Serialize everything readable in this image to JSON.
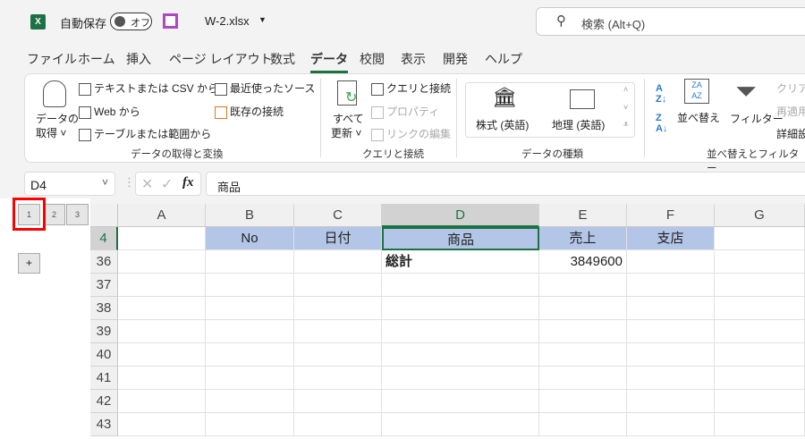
{
  "titlebar": {
    "autosave_label": "自動保存",
    "autosave_state": "オフ",
    "filename": "W-2.xlsx",
    "search_placeholder": "検索 (Alt+Q)"
  },
  "tabs": [
    "ファイル",
    "ホーム",
    "挿入",
    "ページ レイアウト",
    "数式",
    "データ",
    "校閲",
    "表示",
    "開発",
    "ヘルプ"
  ],
  "ribbon": {
    "get_data": {
      "line1": "データの",
      "line2": "取得 ˅",
      "text_csv": "テキストまたは CSV から",
      "web": "Web から",
      "table_range": "テーブルまたは範囲から",
      "recent": "最近使ったソース",
      "existing": "既存の接続",
      "group": "データの取得と変換"
    },
    "queries": {
      "refresh1": "すべて",
      "refresh2": "更新 ˅",
      "queries_conn": "クエリと接続",
      "properties": "プロパティ",
      "edit_links": "リンクの編集",
      "group": "クエリと接続"
    },
    "data_types": {
      "stocks": "株式 (英語)",
      "geography": "地理 (英語)",
      "group": "データの種類"
    },
    "sort_filter": {
      "sort": "並べ替え",
      "filter": "フィルター",
      "clear": "クリア",
      "reapply": "再適用",
      "advanced": "詳細設定",
      "group": "並べ替えとフィルター"
    }
  },
  "formula": {
    "name_box": "D4",
    "fx": "fx",
    "value": "商品"
  },
  "outline": {
    "levels": [
      "1",
      "2",
      "3"
    ],
    "expand": "+"
  },
  "columns": [
    "A",
    "B",
    "C",
    "D",
    "E",
    "F",
    "G"
  ],
  "rows": [
    {
      "num": "4",
      "cells": [
        "",
        "No",
        "日付",
        "商品",
        "売上",
        "支店",
        ""
      ]
    },
    {
      "num": "36",
      "cells": [
        "",
        "",
        "",
        "総計",
        "3849600",
        "",
        ""
      ]
    },
    {
      "num": "37",
      "cells": [
        "",
        "",
        "",
        "",
        "",
        "",
        ""
      ]
    },
    {
      "num": "38",
      "cells": [
        "",
        "",
        "",
        "",
        "",
        "",
        ""
      ]
    },
    {
      "num": "39",
      "cells": [
        "",
        "",
        "",
        "",
        "",
        "",
        ""
      ]
    },
    {
      "num": "40",
      "cells": [
        "",
        "",
        "",
        "",
        "",
        "",
        ""
      ]
    },
    {
      "num": "41",
      "cells": [
        "",
        "",
        "",
        "",
        "",
        "",
        ""
      ]
    },
    {
      "num": "42",
      "cells": [
        "",
        "",
        "",
        "",
        "",
        "",
        ""
      ]
    },
    {
      "num": "43",
      "cells": [
        "",
        "",
        "",
        "",
        "",
        "",
        ""
      ]
    }
  ],
  "colors": {
    "accent": "#1e7145",
    "header_fill": "#b4c6e7",
    "highlight": "#ff0000"
  }
}
